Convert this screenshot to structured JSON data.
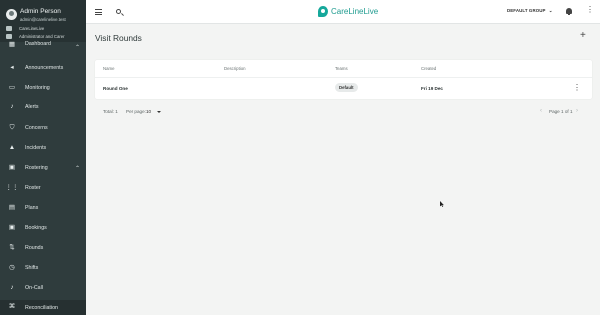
{
  "user": {
    "name": "Admin Person",
    "email": "admin@carelinelive.test",
    "org": "CareLineLive",
    "role": "Administrator and Carer"
  },
  "sidebar": {
    "items": [
      {
        "label": "Dashboard",
        "icon": "dashboard-icon",
        "chevron": "⌃"
      },
      {
        "label": "Announcements",
        "icon": "megaphone-icon"
      },
      {
        "label": "Monitoring",
        "icon": "monitor-icon"
      },
      {
        "label": "Alerts",
        "icon": "bell-icon"
      },
      {
        "label": "Concerns",
        "icon": "shield-icon"
      },
      {
        "label": "Incidents",
        "icon": "warning-icon"
      },
      {
        "label": "Rostering",
        "icon": "calendar-icon",
        "chevron": "⌃"
      },
      {
        "label": "Roster",
        "icon": "grid-icon"
      },
      {
        "label": "Plans",
        "icon": "table-icon"
      },
      {
        "label": "Bookings",
        "icon": "calendar-icon"
      },
      {
        "label": "Rounds",
        "icon": "route-icon"
      },
      {
        "label": "Shifts",
        "icon": "clock-icon"
      },
      {
        "label": "On-Call",
        "icon": "bell-icon"
      },
      {
        "label": "Reconciliation",
        "icon": "command-icon"
      }
    ]
  },
  "topbar": {
    "brand": "CareLineLive",
    "group_label": "DEFAULT GROUP",
    "group_caret": "⌄"
  },
  "main": {
    "title": "Visit Rounds",
    "add_symbol": "+",
    "table": {
      "columns": [
        "Name",
        "Description",
        "Teams",
        "Created"
      ],
      "rows": [
        {
          "name": "Round One",
          "description": "",
          "team": "Default",
          "created": "Fri 19 Dec"
        }
      ]
    },
    "footer": {
      "total": "Total: 1",
      "per_page_label": "Per page:",
      "per_page_value": "10",
      "page_info": "Page 1 of 1",
      "prev": "‹",
      "next": "›"
    }
  }
}
